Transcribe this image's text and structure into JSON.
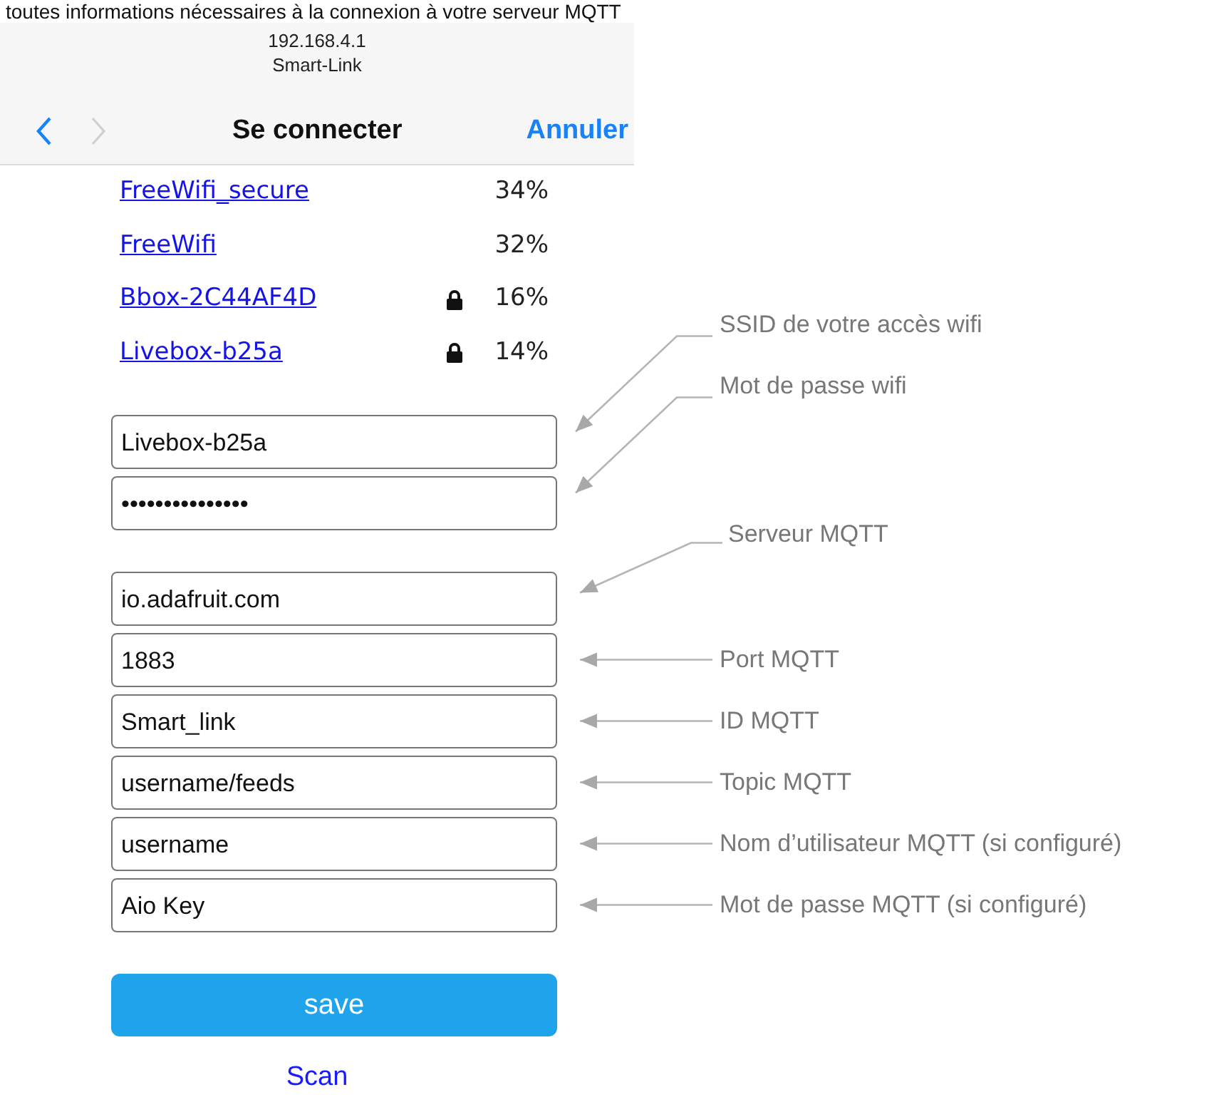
{
  "caption": "toutes informations nécessaires à la connexion à votre serveur MQTT",
  "browser": {
    "url": "192.168.4.1",
    "page_title": "Smart-Link",
    "title": "Se connecter",
    "cancel": "Annuler",
    "back_enabled": true,
    "forward_enabled": false
  },
  "networks": [
    {
      "ssid": "FreeWifi_secure",
      "locked": false,
      "signal": "34%"
    },
    {
      "ssid": "FreeWifi",
      "locked": false,
      "signal": "32%"
    },
    {
      "ssid": "Bbox-2C44AF4D",
      "locked": true,
      "signal": "16%"
    },
    {
      "ssid": "Livebox-b25a",
      "locked": true,
      "signal": "14%"
    }
  ],
  "wifi_fields": [
    {
      "value": "Livebox-b25a",
      "annotation": "SSID de votre accès wifi",
      "kind": "steep"
    },
    {
      "value": "•••••••••••••••",
      "annotation": "Mot de passe wifi",
      "kind": "steep"
    }
  ],
  "mqtt_fields": [
    {
      "value": "io.adafruit.com",
      "annotation": "Serveur MQTT",
      "kind": "shallow"
    },
    {
      "value": "1883",
      "annotation": "Port MQTT",
      "kind": "straight"
    },
    {
      "value": "Smart_link",
      "annotation": "ID MQTT",
      "kind": "straight"
    },
    {
      "value": "username/feeds",
      "annotation": "Topic MQTT",
      "kind": "straight"
    },
    {
      "value": "username",
      "annotation": "Nom d’utilisateur MQTT (si configuré)",
      "kind": "straight"
    },
    {
      "value": "Aio Key",
      "annotation": "Mot de passe MQTT (si configuré)",
      "kind": "straight"
    }
  ],
  "save_button": "save",
  "scan_link": "Scan"
}
